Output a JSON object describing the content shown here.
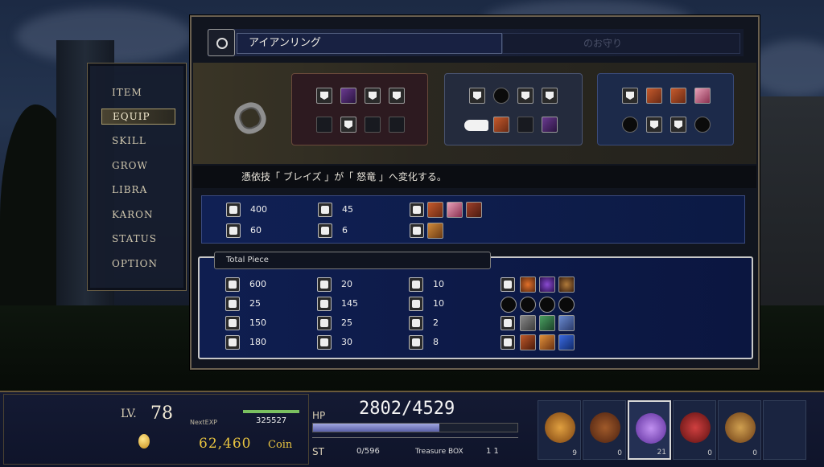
{
  "menu": {
    "items": [
      "ITEM",
      "EQUIP",
      "SKILL",
      "GROW",
      "LIBRA",
      "KARON",
      "STATUS",
      "OPTION"
    ],
    "selected": "EQUIP"
  },
  "equip": {
    "item_name": "アイアンリング",
    "ghost_title": "のお守り",
    "description": "憑依技「 ブレイズ 」が「 怒竜 」へ変化する。"
  },
  "item_stats": {
    "hp": "400",
    "def": "45",
    "armor": "60",
    "boot": "6"
  },
  "total_piece": {
    "label": "Total Piece",
    "col1": [
      "600",
      "25",
      "150",
      "180"
    ],
    "col2": [
      "20",
      "145",
      "25",
      "30"
    ],
    "col3": [
      "10",
      "10",
      "2",
      "8"
    ]
  },
  "hud": {
    "lv_label": "LV.",
    "lv": "78",
    "nextexp_label": "NextEXP",
    "nextexp": "325527",
    "coin": "62,460",
    "coin_label": "Coin",
    "hp_label": "HP",
    "hp": "2802/4529",
    "hp_ratio": 0.619,
    "st_label": "ST",
    "st": "0/596",
    "treasure_label": "Treasure BOX",
    "treasure": "1 1",
    "items": [
      {
        "name": "pineapple-fruit",
        "count": "9",
        "color": "#c8841e"
      },
      {
        "name": "fig-fruit",
        "count": "0",
        "color": "#8a4a24"
      },
      {
        "name": "purple-crystal",
        "count": "21",
        "color": "#8a5ad0"
      },
      {
        "name": "red-potion",
        "count": "0",
        "color": "#a02830"
      },
      {
        "name": "burger",
        "count": "0",
        "color": "#b07a30"
      }
    ]
  }
}
